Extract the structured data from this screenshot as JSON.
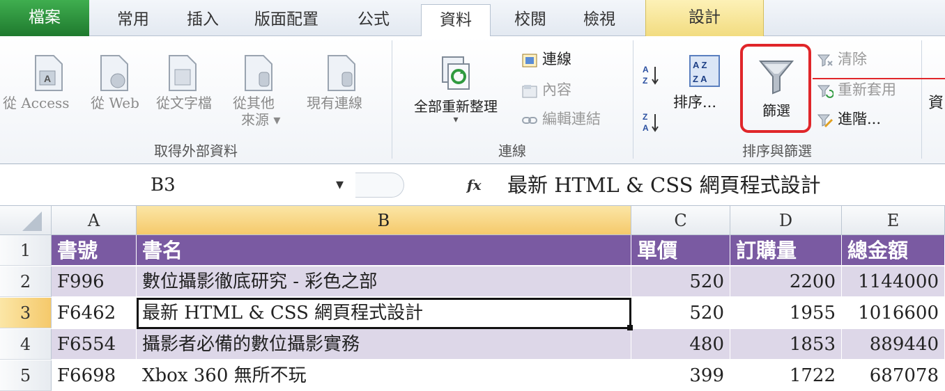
{
  "tabs": [
    {
      "label": "檔案"
    },
    {
      "label": "常用"
    },
    {
      "label": "插入"
    },
    {
      "label": "版面配置"
    },
    {
      "label": "公式"
    },
    {
      "label": "資料"
    },
    {
      "label": "校閱"
    },
    {
      "label": "檢視"
    },
    {
      "label": "設計"
    }
  ],
  "ribbon": {
    "external": {
      "label": "取得外部資料",
      "access": "從 Access",
      "web": "從 Web",
      "text": "從文字檔",
      "other1": "從其他",
      "other2": "來源 ▾",
      "existing": "現有連線"
    },
    "connections": {
      "label": "連線",
      "refresh_all": "全部重新整理",
      "refresh_arrow": "▾",
      "conn": "連線",
      "props": "內容",
      "edit_links": "編輯連結"
    },
    "sort_filter": {
      "label": "排序與篩選",
      "sort": "排序...",
      "filter": "篩選",
      "clear": "清除",
      "reapply": "重新套用",
      "advanced": "進階..."
    },
    "data_tools_partial": "資"
  },
  "formula_bar": {
    "name_box": "B3",
    "fx": "fx",
    "formula": "最新 HTML & CSS 網頁程式設計"
  },
  "sheet": {
    "columns": [
      "A",
      "B",
      "C",
      "D",
      "E"
    ],
    "row_numbers": [
      "1",
      "2",
      "3",
      "4",
      "5"
    ],
    "header": [
      "書號",
      "書名",
      "單價",
      "訂購量",
      "總金額"
    ],
    "rows": [
      [
        "F996",
        "數位攝影徹底研究 - 彩色之部",
        "520",
        "2200",
        "1144000"
      ],
      [
        "F6462",
        "最新 HTML & CSS 網頁程式設計",
        "520",
        "1955",
        "1016600"
      ],
      [
        "F6554",
        "攝影者必備的數位攝影實務",
        "480",
        "1853",
        "889440"
      ],
      [
        "F6698",
        "Xbox 360 無所不玩",
        "399",
        "1722",
        "687078"
      ]
    ]
  },
  "colors": {
    "header_fill": "#7a5aa2",
    "band_fill": "#ddd7e8",
    "highlight": "#e0262a",
    "file_tab": "#2a8a3a"
  }
}
